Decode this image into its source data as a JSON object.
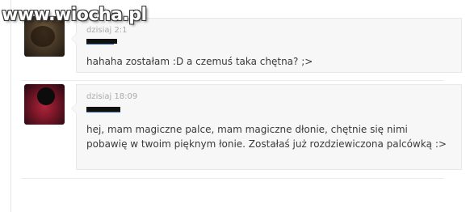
{
  "site": {
    "watermark": "www.wiocha.pl"
  },
  "messages": [
    {
      "timestamp": "dzisiaj 2:1",
      "text": "hahaha zostałam :D a czemuś taka chętna? ;>"
    },
    {
      "timestamp": "dzisiaj 18:09",
      "text": "hej, mam magiczne palce, mam magiczne dłonie, chętnie się nimi pobawię w twoim pięknym łonie. Zostałaś już rozdziewiczona palcówką :>"
    }
  ]
}
